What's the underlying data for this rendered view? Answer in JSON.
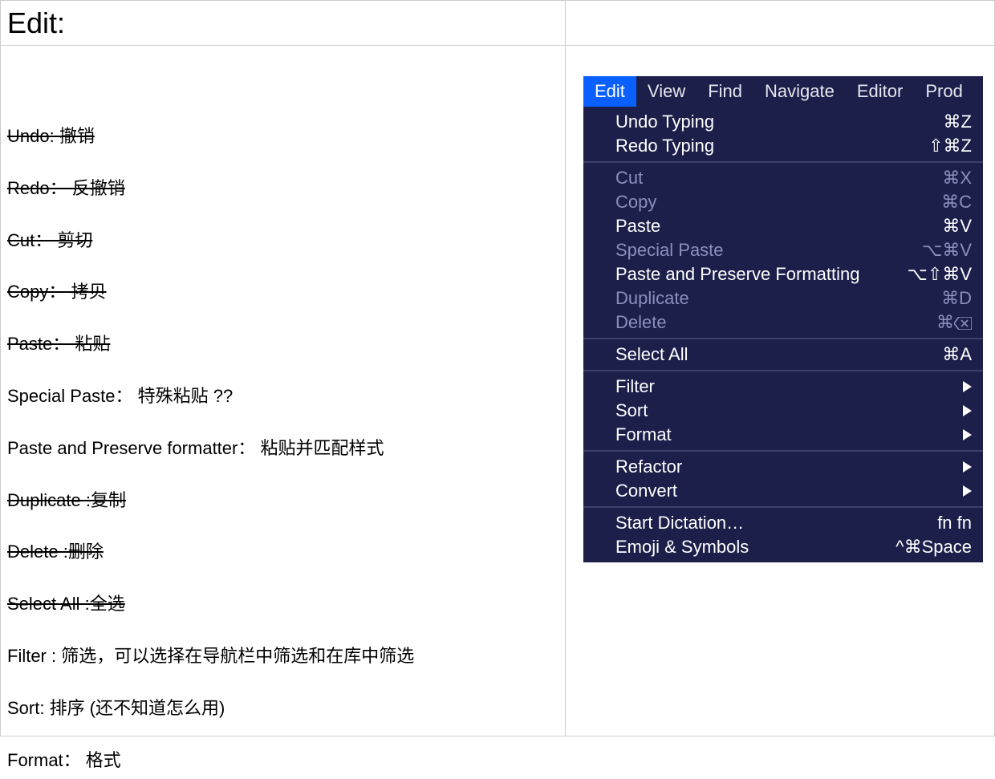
{
  "left": {
    "title": "Edit:",
    "items": [
      {
        "text": "Undo: 撤销",
        "strike": true
      },
      {
        "text": "Redo： 反撤销",
        "strike": true
      },
      {
        "text": "Cut： 剪切",
        "strike": true
      },
      {
        "text": "Copy： 拷贝",
        "strike": true
      },
      {
        "text": "Paste： 粘贴",
        "strike": true
      },
      {
        "text": "Special Paste： 特殊粘贴 ??",
        "strike": false
      },
      {
        "text": "Paste and Preserve formatter： 粘贴并匹配样式",
        "strike": false
      },
      {
        "text": "Duplicate :复制",
        "strike": true
      },
      {
        "text": "Delete :删除",
        "strike": true
      },
      {
        "text": "Select All :全选",
        "strike": true
      },
      {
        "text": "Filter : 筛选，可以选择在导航栏中筛选和在库中筛选",
        "strike": false
      },
      {
        "text": "Sort:  排序 (还不知道怎么用)",
        "strike": false
      },
      {
        "text": "Format： 格式",
        "strike": false
      }
    ]
  },
  "menubar": {
    "items": [
      "Edit",
      "View",
      "Find",
      "Navigate",
      "Editor",
      "Prod"
    ],
    "selected_index": 0
  },
  "menu": {
    "groups": [
      [
        {
          "label": "Undo Typing",
          "shortcut": "⌘Z",
          "enabled": true
        },
        {
          "label": "Redo Typing",
          "shortcut": "⇧⌘Z",
          "enabled": true
        }
      ],
      [
        {
          "label": "Cut",
          "shortcut": "⌘X",
          "enabled": false
        },
        {
          "label": "Copy",
          "shortcut": "⌘C",
          "enabled": false
        },
        {
          "label": "Paste",
          "shortcut": "⌘V",
          "enabled": true
        },
        {
          "label": "Special Paste",
          "shortcut": "⌥⌘V",
          "enabled": false
        },
        {
          "label": "Paste and Preserve Formatting",
          "shortcut": "⌥⇧⌘V",
          "enabled": true
        },
        {
          "label": "Duplicate",
          "shortcut": "⌘D",
          "enabled": false
        },
        {
          "label": "Delete",
          "shortcut": "⌘⌫",
          "enabled": false,
          "delete_icon": true
        }
      ],
      [
        {
          "label": "Select All",
          "shortcut": "⌘A",
          "enabled": true
        }
      ],
      [
        {
          "label": "Filter",
          "submenu": true,
          "enabled": true
        },
        {
          "label": "Sort",
          "submenu": true,
          "enabled": true
        },
        {
          "label": "Format",
          "submenu": true,
          "enabled": true
        }
      ],
      [
        {
          "label": "Refactor",
          "submenu": true,
          "enabled": true
        },
        {
          "label": "Convert",
          "submenu": true,
          "enabled": true
        }
      ],
      [
        {
          "label": "Start Dictation…",
          "shortcut": "fn fn",
          "enabled": true
        },
        {
          "label": "Emoji & Symbols",
          "shortcut": "^⌘Space",
          "enabled": true
        }
      ]
    ]
  }
}
